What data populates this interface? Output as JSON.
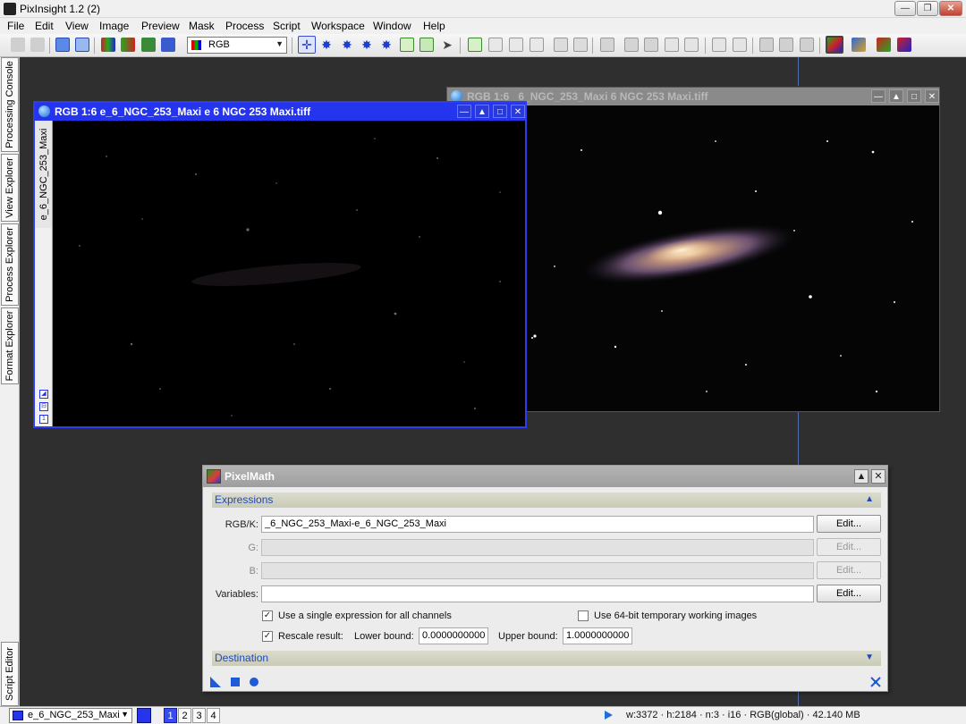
{
  "app": {
    "title": "PixInsight 1.2 (2)"
  },
  "menu": [
    "File",
    "Edit",
    "View",
    "Image",
    "Preview",
    "Mask",
    "Process",
    "Script",
    "Workspace",
    "Window",
    "Help"
  ],
  "toolbar": {
    "color_space": "RGB"
  },
  "left_dock": {
    "tabs": [
      "Processing Console",
      "View Explorer",
      "Process Explorer",
      "Format Explorer"
    ],
    "bottom_tab": "Script Editor"
  },
  "image_windows": {
    "active": {
      "title": "RGB 1:6 e_6_NGC_253_Maxi e 6 NGC 253 Maxi.tiff",
      "view_tab": "e_6_NGC_253_Maxi"
    },
    "background": {
      "title": "RGB 1:6 _6_NGC_253_Maxi 6 NGC 253 Maxi.tiff"
    }
  },
  "pixelmath": {
    "title": "PixelMath",
    "expressions_section": "Expressions",
    "destination_section": "Destination",
    "rows": [
      {
        "label": "RGB/K:",
        "value": "_6_NGC_253_Maxi-e_6_NGC_253_Maxi",
        "button": "Edit...",
        "enabled": true
      },
      {
        "label": "G:",
        "value": "",
        "button": "Edit...",
        "enabled": false
      },
      {
        "label": "B:",
        "value": "",
        "button": "Edit...",
        "enabled": false
      },
      {
        "label": "Variables:",
        "value": "",
        "button": "Edit...",
        "enabled": true
      }
    ],
    "single_expression_label": "Use a single expression for all channels",
    "single_expression_checked": true,
    "use64_label": "Use 64-bit temporary working images",
    "use64_checked": false,
    "rescale_label": "Rescale result:",
    "rescale_checked": true,
    "lower_bound_label": "Lower bound:",
    "lower_bound": "0.0000000000",
    "upper_bound_label": "Upper bound:",
    "upper_bound": "1.0000000000"
  },
  "statusbar": {
    "view": "e_6_NGC_253_Maxi",
    "workspaces": [
      "1",
      "2",
      "3",
      "4"
    ],
    "active_workspace": "1",
    "info": "w:3372 · h:2184 · n:3 · i16 · RGB(global) · 42.140 MB"
  }
}
